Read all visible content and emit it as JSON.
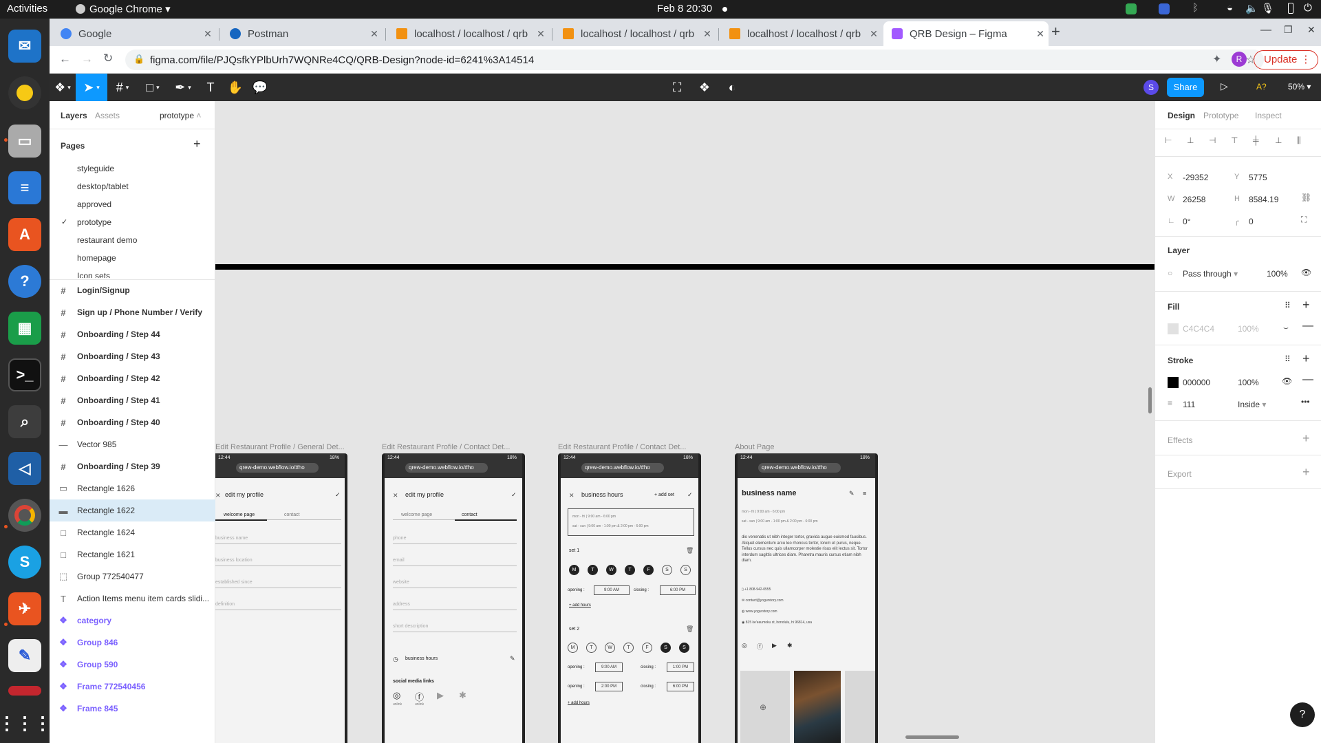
{
  "system": {
    "activities": "Activities",
    "app_menu": "Google Chrome",
    "datetime": "Feb 8  20:30"
  },
  "browser": {
    "tabs": [
      {
        "title": "Google",
        "color": "#4285f4"
      },
      {
        "title": "Postman",
        "color": "#1565c0"
      },
      {
        "title": "localhost / localhost / qrb",
        "color": "#f29111"
      },
      {
        "title": "localhost / localhost / qrb",
        "color": "#f29111"
      },
      {
        "title": "localhost / localhost / qrb",
        "color": "#f29111"
      },
      {
        "title": "QRB Design – Figma",
        "color": "#a259ff"
      }
    ],
    "url": "figma.com/file/PJQsfkYPlbUrh7WQNRe4CQ/QRB-Design?node-id=6241%3A14514",
    "update_label": "Update",
    "profile_initial": "R"
  },
  "figma_toolbar": {
    "share_label": "Share",
    "zoom": "50%",
    "user_initial": "S",
    "missing_fonts": "A?"
  },
  "left_panel": {
    "tabs": [
      "Layers",
      "Assets"
    ],
    "current_page": "prototype",
    "pages_heading": "Pages",
    "pages": [
      "styleguide",
      "desktop/tablet",
      "approved",
      "prototype",
      "restaurant demo",
      "homepage",
      "Icon sets"
    ],
    "layers": [
      {
        "name": "Login/Signup",
        "kind": "frame"
      },
      {
        "name": "Sign up / Phone Number / Verify",
        "kind": "frame"
      },
      {
        "name": "Onboarding / Step 44",
        "kind": "frame"
      },
      {
        "name": "Onboarding / Step 43",
        "kind": "frame"
      },
      {
        "name": "Onboarding / Step 42",
        "kind": "frame"
      },
      {
        "name": "Onboarding / Step 41",
        "kind": "frame"
      },
      {
        "name": "Onboarding / Step 40",
        "kind": "frame"
      },
      {
        "name": "Vector 985",
        "kind": "vector"
      },
      {
        "name": "Onboarding / Step 39",
        "kind": "frame"
      },
      {
        "name": "Rectangle 1626",
        "kind": "rect"
      },
      {
        "name": "Rectangle 1622",
        "kind": "rect",
        "selected": true
      },
      {
        "name": "Rectangle 1624",
        "kind": "rect"
      },
      {
        "name": "Rectangle 1621",
        "kind": "rect"
      },
      {
        "name": "Group 772540477",
        "kind": "group"
      },
      {
        "name": "Action Items menu item cards slidi...",
        "kind": "text"
      },
      {
        "name": "category",
        "kind": "component"
      },
      {
        "name": "Group 846",
        "kind": "component"
      },
      {
        "name": "Group 590",
        "kind": "component"
      },
      {
        "name": "Frame 772540456",
        "kind": "component"
      },
      {
        "name": "Frame 845",
        "kind": "component"
      }
    ]
  },
  "right_panel": {
    "tabs": [
      "Design",
      "Prototype",
      "Inspect"
    ],
    "x": "-29352",
    "y": "5775",
    "w": "26258",
    "h": "8584.19",
    "rotation": "0°",
    "radius": "0",
    "layer_heading": "Layer",
    "blend": "Pass through",
    "layer_opacity": "100%",
    "fill_heading": "Fill",
    "fill_hex": "C4C4C4",
    "fill_opacity": "100%",
    "stroke_heading": "Stroke",
    "stroke_hex": "000000",
    "stroke_opacity": "100%",
    "stroke_weight": "111",
    "stroke_align": "Inside",
    "effects_heading": "Effects",
    "export_heading": "Export"
  },
  "canvas": {
    "frames": [
      {
        "label": "Edit Restaurant Profile / General Det...",
        "title": "edit my profile",
        "tabs": [
          "welcome page",
          "contact"
        ],
        "fields": [
          "business name",
          "business location",
          "established since",
          "definition"
        ]
      },
      {
        "label": "Edit Restaurant Profile / Contact Det...",
        "title": "edit my profile",
        "tabs": [
          "welcome page",
          "contact"
        ],
        "fields": [
          "phone",
          "email",
          "website",
          "address",
          "short description"
        ],
        "hours_label": "business hours",
        "social_label": "social media links",
        "unlink": "unlink"
      },
      {
        "label": "Edit Restaurant Profile / Contact Det...",
        "title": "business hours",
        "add_set": "+ add set",
        "summary1": "mon - fri  |  9:00 am - 6:00 pm",
        "summary2": "sat - sun  |  9:00 am - 1:00 pm  &  2:00 pm - 6:00 pm",
        "set1": "set 1",
        "set2": "set 2",
        "days": [
          "M",
          "T",
          "W",
          "T",
          "F",
          "S",
          "S"
        ],
        "opening": "opening :",
        "closing": "closing :",
        "t_open1": "9:00 AM",
        "t_close1": "6:00 PM",
        "t_open2": "9:00 AM",
        "t_close2": "1:00 PM",
        "t_open3": "2:00 PM",
        "t_close3": "6:00 PM",
        "add_hours": "+ add hours"
      },
      {
        "label": "About Page",
        "title": "business name",
        "hours1": "mon - fri  |  9:00 am - 6:00 pm",
        "hours2": "sat - sun  |  9:00 am - 1:00 pm  &  2:00 pm - 6:00 pm",
        "desc": "dio venenatis ut nibh integer tortor, gravida augue euismod faucibus. Aliquet elementum arcu leo rhoncus tortor, lorem et purus, neque. Tellus cursus nec quis ullamcorper molestie risus elit lectus sit. Tortor interdum sagittis ultrices diam. Pharetra mauris cursus etiam nibh diam.",
        "phone": "+1 808-942-0555",
        "email": "contact@yogurstory.com",
        "web": "www.yogurstory.com",
        "address": "815 ke'eaumoku st, honolulu, hi 96814, usa"
      }
    ],
    "status_time": "12:44",
    "status_batt": "18%",
    "phone_url": "qrew-demo.webflow.io/#ho"
  },
  "colors": {
    "figma_blue": "#0d99ff",
    "selection": "#daebf7",
    "component": "#7b61ff",
    "chrome_update": "#d93025"
  }
}
